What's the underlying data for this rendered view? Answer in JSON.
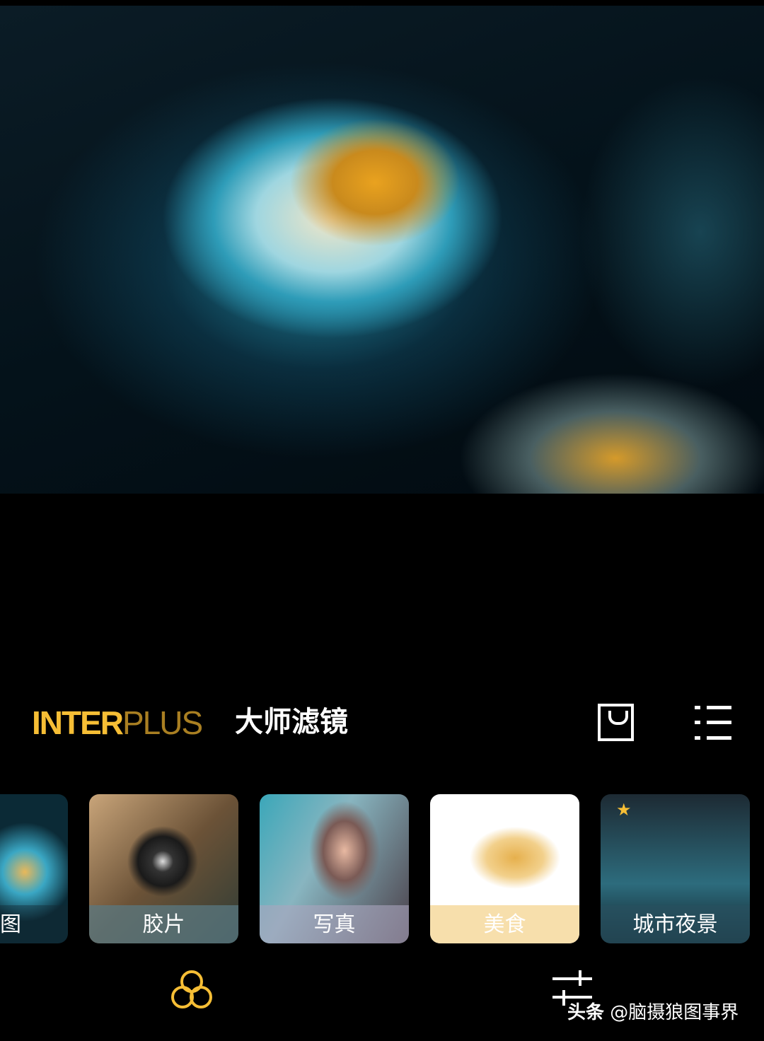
{
  "preview": {
    "subject": "chrysanthemum photo"
  },
  "toolbar": {
    "brand_bold": "INTER",
    "brand_light": "PLUS",
    "title": "大师滤镜",
    "shop_icon": "shopping-bag-icon",
    "menu_icon": "list-icon"
  },
  "filters": [
    {
      "label": "图",
      "partial": true
    },
    {
      "label": "胶片"
    },
    {
      "label": "写真"
    },
    {
      "label": "美食"
    },
    {
      "label": "城市夜景",
      "starred": true
    }
  ],
  "bottom_nav": {
    "filter_icon": "filter-circles-icon",
    "adjust_icon": "sliders-icon"
  },
  "watermark": {
    "prefix": "头条",
    "text": "@脑摄狼图事界"
  },
  "colors": {
    "accent": "#f6be35",
    "brand_light": "#a97f22"
  }
}
